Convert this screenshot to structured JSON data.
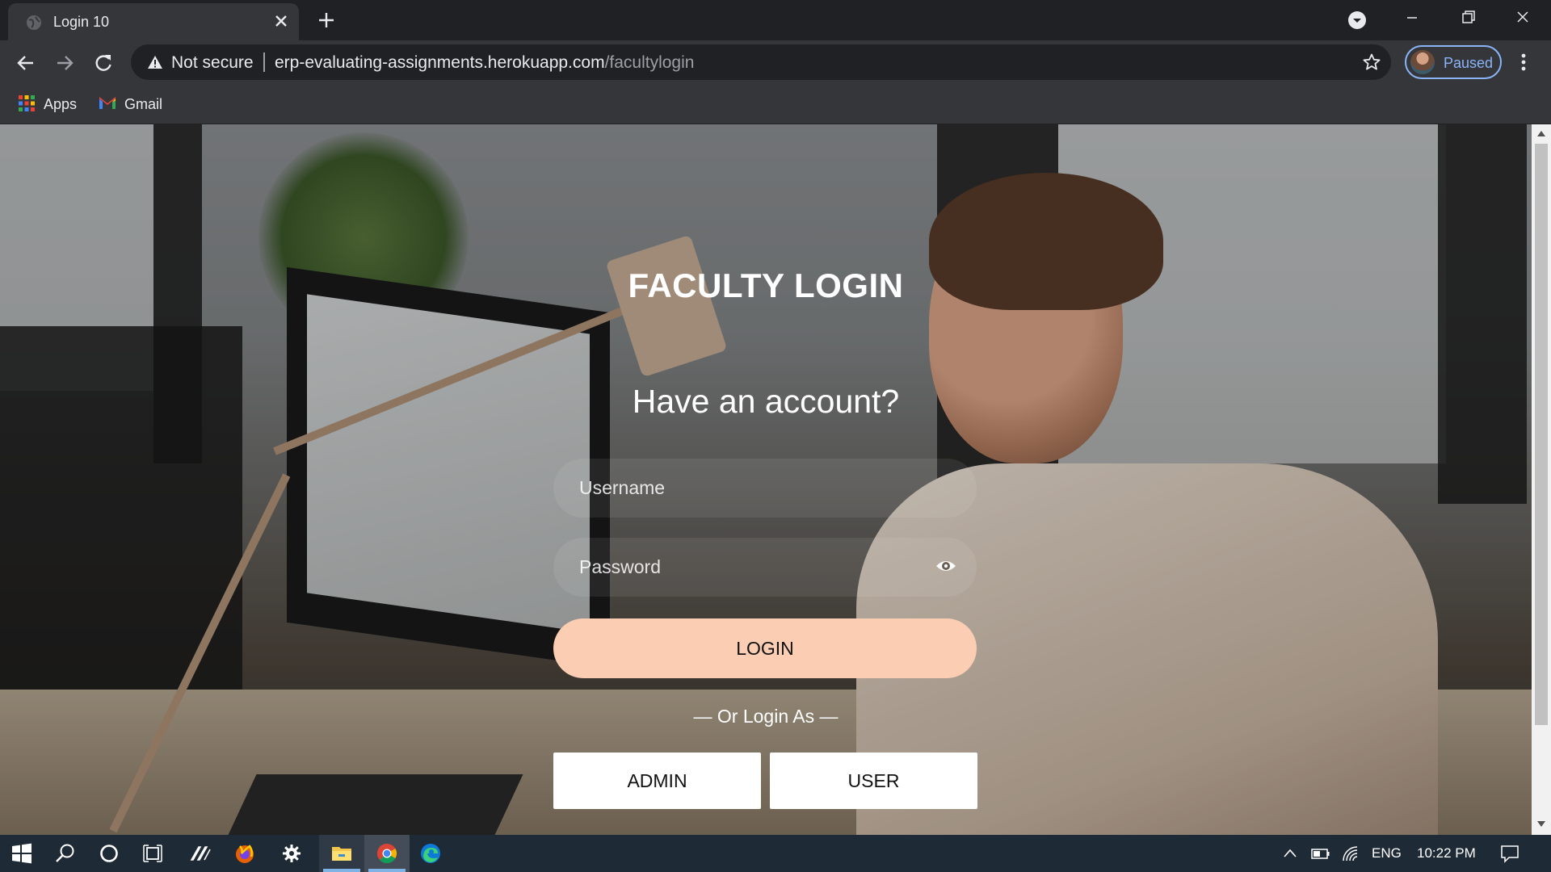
{
  "browser": {
    "tab_title": "Login 10",
    "security_label": "Not secure",
    "url_host": "erp-evaluating-assignments.herokuapp.com",
    "url_path": "/facultylogin",
    "profile_label": "Paused",
    "bookmarks": [
      {
        "label": "Apps",
        "icon": "apps-grid-icon"
      },
      {
        "label": "Gmail",
        "icon": "gmail-icon"
      }
    ]
  },
  "page": {
    "title": "FACULTY LOGIN",
    "subtitle": "Have an account?",
    "username_placeholder": "Username",
    "password_placeholder": "Password",
    "login_label": "LOGIN",
    "or_text": "— Or Login As —",
    "admin_label": "ADMIN",
    "user_label": "USER",
    "accent_color": "#fbcdb3"
  },
  "taskbar": {
    "language": "ENG",
    "time": "10:22 PM",
    "apps": [
      "windows-start-icon",
      "search-icon",
      "cortana-icon",
      "task-view-icon",
      "pen-app-icon",
      "firefox-icon",
      "settings-icon",
      "file-explorer-icon",
      "chrome-icon",
      "edge-icon"
    ]
  }
}
